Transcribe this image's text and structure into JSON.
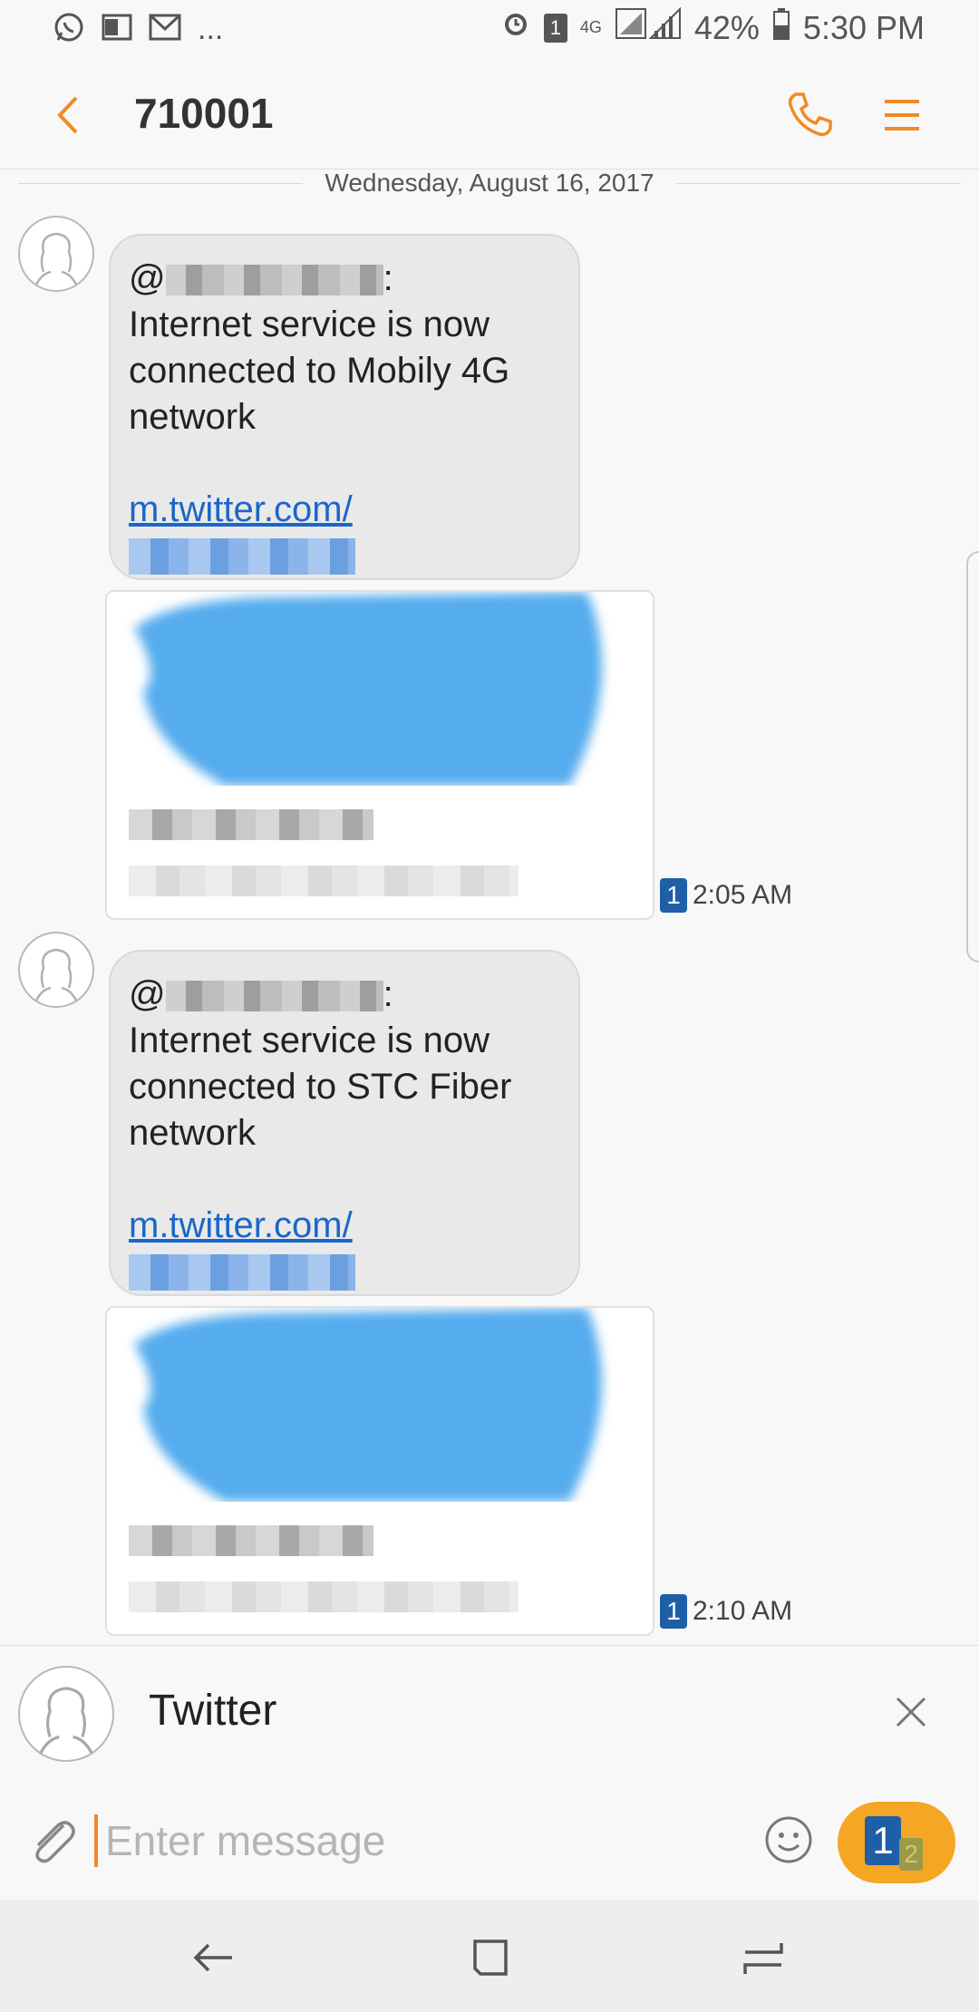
{
  "status_bar": {
    "left_icons": [
      "whatsapp-icon",
      "outlook-icon",
      "gmail-icon"
    ],
    "overflow": "...",
    "network": "4G",
    "battery_pct": "42%",
    "time": "5:30 PM",
    "sim_indicator": "1"
  },
  "header": {
    "title": "710001"
  },
  "conversation": {
    "date": "Wednesday, August 16, 2017",
    "messages": [
      {
        "at": "@",
        "colon": ":",
        "text_lines": [
          "Internet service is now",
          "connected to Mobily 4G",
          "network"
        ],
        "link": "m.twitter.com/",
        "sim": "1",
        "time": "2:05 AM"
      },
      {
        "at": "@",
        "colon": ":",
        "text_lines": [
          "Internet service is now",
          "connected to STC Fiber",
          "network"
        ],
        "link": "m.twitter.com/",
        "sim": "1",
        "time": "2:10 AM"
      }
    ]
  },
  "recipient": {
    "name": "Twitter"
  },
  "composer": {
    "placeholder": "Enter message",
    "sim_primary": "1",
    "sim_secondary": "2"
  },
  "colors": {
    "accent": "#f08a24",
    "link": "#1b66c9",
    "sim_blue": "#1f5fa8",
    "send": "#f5a623"
  }
}
